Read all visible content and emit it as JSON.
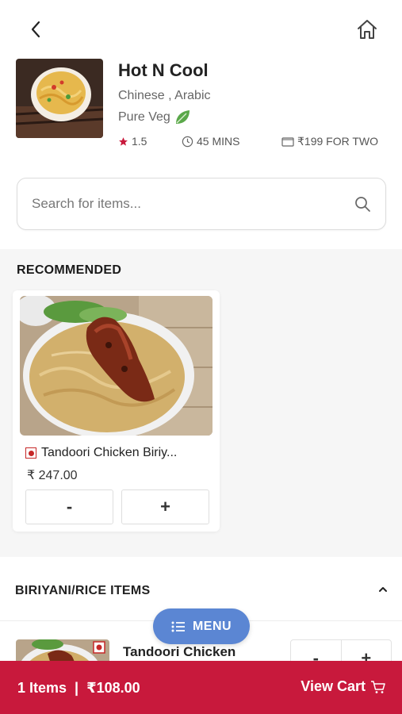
{
  "header": {
    "back_icon": "chevron-left-icon",
    "home_icon": "home-icon"
  },
  "restaurant": {
    "name": "Hot N Cool",
    "cuisine": "Chinese , Arabic",
    "diet": "Pure Veg",
    "rating": "1.5",
    "time": "45 MINS",
    "cost": "₹199 FOR TWO"
  },
  "search": {
    "placeholder": "Search for items..."
  },
  "recommended": {
    "title": "RECOMMENDED",
    "items": [
      {
        "name": "Tandoori Chicken Biriy...",
        "price": "₹ 247.00",
        "minus": "-",
        "plus": "+"
      }
    ]
  },
  "category": {
    "title": "BIRIYANI/RICE ITEMS"
  },
  "list_items": [
    {
      "name": "Tandoori Chicken",
      "minus": "-",
      "plus": "+"
    }
  ],
  "menu_button": {
    "label": "MENU"
  },
  "cart": {
    "items": "1 Items",
    "separator": "|",
    "total": "₹108.00",
    "view_label": "View Cart"
  },
  "colors": {
    "brand": "#c8193c",
    "menu_fab": "#5b86d3",
    "rating_star": "#c8193c",
    "veg_leaf": "#4caf50"
  }
}
